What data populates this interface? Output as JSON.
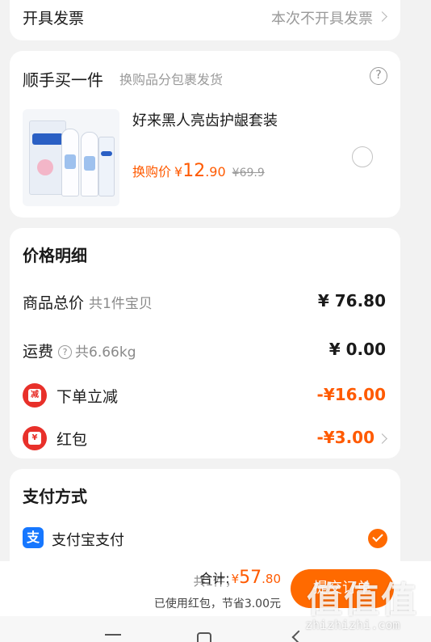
{
  "invoice": {
    "label": "开具发票",
    "value": "本次不开具发票"
  },
  "addon": {
    "title": "顺手买一件",
    "subtitle": "换购品分包裹发货",
    "product_name": "好来黑人亮齿护龈套装",
    "price_label": "换购价",
    "currency": "¥",
    "price_int": "12",
    "price_dec": ".90",
    "original_price": "¥69.9",
    "selected": false
  },
  "price_details": {
    "title": "价格明细",
    "goods_total_label": "商品总价",
    "goods_total_sub": "共1件宝贝",
    "goods_total_value": "¥ 76.80",
    "shipping_label": "运费",
    "shipping_sub": "共6.66kg",
    "shipping_value": "¥ 0.00",
    "discount_label": "下单立减",
    "discount_badge": "减",
    "discount_value": "-¥16.00",
    "redpacket_label": "红包",
    "redpacket_badge": "¥",
    "redpacket_value": "-¥3.00"
  },
  "payment": {
    "title": "支付方式",
    "method_icon": "支",
    "method_label": "支付宝支付",
    "selected": true
  },
  "bottom_bar": {
    "count": "共1件，",
    "total_label": "合计:",
    "currency": "¥",
    "total_int": "57",
    "total_dec": ".80",
    "saving": "已使用红包，节省3.00元",
    "submit_label": "提交订单"
  },
  "watermark": {
    "big": "值值值",
    "small": "zhizhizhi.com"
  },
  "colors": {
    "accent": "#ff6a00",
    "price": "#ff5a00",
    "badge_red": "#e8302a",
    "alipay_blue": "#1677ff"
  }
}
